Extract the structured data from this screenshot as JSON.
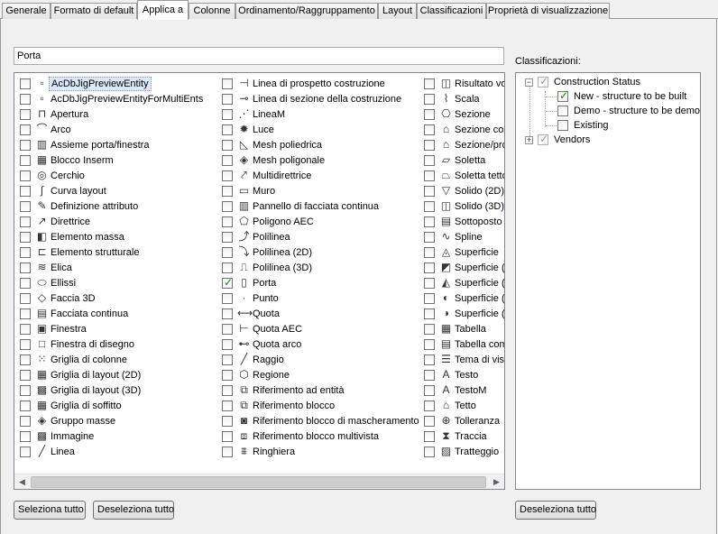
{
  "tabs": [
    {
      "label": "Generale"
    },
    {
      "label": "Formato di default"
    },
    {
      "label": "Applica a"
    },
    {
      "label": "Colonne"
    },
    {
      "label": "Ordinamento/Raggruppamento"
    },
    {
      "label": "Layout"
    },
    {
      "label": "Classificazioni"
    },
    {
      "label": "Proprietà di visualizzazione"
    }
  ],
  "active_tab": "Applica a",
  "filter": {
    "value": "Porta"
  },
  "objects": {
    "col1": [
      {
        "label": "AcDbJigPreviewEntity",
        "checked": false,
        "icon": "jig-preview-icon"
      },
      {
        "label": "AcDbJigPreviewEntityForMultiEnts",
        "checked": false,
        "icon": "jig-preview-icon"
      },
      {
        "label": "Apertura",
        "checked": false,
        "icon": "opening-icon"
      },
      {
        "label": "Arco",
        "checked": false,
        "icon": "arc-icon"
      },
      {
        "label": "Assieme porta/finestra",
        "checked": false,
        "icon": "door-window-assembly-icon"
      },
      {
        "label": "Blocco Inserm",
        "checked": false,
        "icon": "block-icon"
      },
      {
        "label": "Cerchio",
        "checked": false,
        "icon": "circle-icon"
      },
      {
        "label": "Curva layout",
        "checked": false,
        "icon": "layout-curve-icon"
      },
      {
        "label": "Definizione attributo",
        "checked": false,
        "icon": "attribute-definition-icon"
      },
      {
        "label": "Direttrice",
        "checked": false,
        "icon": "leader-icon"
      },
      {
        "label": "Elemento massa",
        "checked": false,
        "icon": "mass-element-icon"
      },
      {
        "label": "Elemento strutturale",
        "checked": false,
        "icon": "structural-member-icon"
      },
      {
        "label": "Elica",
        "checked": false,
        "icon": "helix-icon"
      },
      {
        "label": "Ellissi",
        "checked": false,
        "icon": "ellipse-icon"
      },
      {
        "label": "Faccia 3D",
        "checked": false,
        "icon": "face3d-icon"
      },
      {
        "label": "Facciata continua",
        "checked": false,
        "icon": "curtain-wall-icon"
      },
      {
        "label": "Finestra",
        "checked": false,
        "icon": "window-icon"
      },
      {
        "label": "Finestra di disegno",
        "checked": false,
        "icon": "viewport-icon"
      },
      {
        "label": "Griglia di colonne",
        "checked": false,
        "icon": "column-grid-icon"
      },
      {
        "label": "Griglia di layout (2D)",
        "checked": false,
        "icon": "layout-grid-2d-icon"
      },
      {
        "label": "Griglia di layout (3D)",
        "checked": false,
        "icon": "layout-grid-3d-icon"
      },
      {
        "label": "Griglia di soffitto",
        "checked": false,
        "icon": "ceiling-grid-icon"
      },
      {
        "label": "Gruppo masse",
        "checked": false,
        "icon": "mass-group-icon"
      },
      {
        "label": "Immagine",
        "checked": false,
        "icon": "image-icon"
      },
      {
        "label": "Linea",
        "checked": false,
        "icon": "line-icon"
      }
    ],
    "col2": [
      {
        "label": "Linea di prospetto costruzione",
        "checked": false,
        "icon": "elevation-line-icon"
      },
      {
        "label": "Linea di sezione della costruzione",
        "checked": false,
        "icon": "section-line-icon"
      },
      {
        "label": "LineaM",
        "checked": false,
        "icon": "mline-icon"
      },
      {
        "label": "Luce",
        "checked": false,
        "icon": "light-icon"
      },
      {
        "label": "Mesh poliedrica",
        "checked": false,
        "icon": "polyface-mesh-icon"
      },
      {
        "label": "Mesh poligonale",
        "checked": false,
        "icon": "polygon-mesh-icon"
      },
      {
        "label": "Multidirettrice",
        "checked": false,
        "icon": "multileader-icon"
      },
      {
        "label": "Muro",
        "checked": false,
        "icon": "wall-icon"
      },
      {
        "label": "Pannello di facciata continua",
        "checked": false,
        "icon": "curtain-panel-icon"
      },
      {
        "label": "Poligono AEC",
        "checked": false,
        "icon": "aec-polygon-icon"
      },
      {
        "label": "Polilinea",
        "checked": false,
        "icon": "polyline-icon"
      },
      {
        "label": "Polilinea (2D)",
        "checked": false,
        "icon": "polyline-2d-icon"
      },
      {
        "label": "Polilinea (3D)",
        "checked": false,
        "icon": "polyline-3d-icon"
      },
      {
        "label": "Porta",
        "checked": true,
        "icon": "door-icon"
      },
      {
        "label": "Punto",
        "checked": false,
        "icon": "point-icon"
      },
      {
        "label": "Quota",
        "checked": false,
        "icon": "dimension-icon"
      },
      {
        "label": "Quota AEC",
        "checked": false,
        "icon": "aec-dimension-icon"
      },
      {
        "label": "Quota arco",
        "checked": false,
        "icon": "arc-dimension-icon"
      },
      {
        "label": "Raggio",
        "checked": false,
        "icon": "ray-icon"
      },
      {
        "label": "Regione",
        "checked": false,
        "icon": "region-icon"
      },
      {
        "label": "Riferimento ad entità",
        "checked": false,
        "icon": "entity-reference-icon"
      },
      {
        "label": "Riferimento blocco",
        "checked": false,
        "icon": "block-reference-icon"
      },
      {
        "label": "Riferimento blocco di mascheramento",
        "checked": false,
        "icon": "masking-block-icon"
      },
      {
        "label": "Riferimento blocco multivista",
        "checked": false,
        "icon": "multiview-block-icon"
      },
      {
        "label": "Ringhiera",
        "checked": false,
        "icon": "railing-icon"
      }
    ],
    "col3": [
      {
        "label": "Risultato vo",
        "checked": false,
        "icon": "volume-result-icon"
      },
      {
        "label": "Scala",
        "checked": false,
        "icon": "stair-icon"
      },
      {
        "label": "Sezione",
        "checked": false,
        "icon": "section-icon"
      },
      {
        "label": "Sezione cos",
        "checked": false,
        "icon": "building-section-icon"
      },
      {
        "label": "Sezione/pro",
        "checked": false,
        "icon": "section-profile-icon"
      },
      {
        "label": "Soletta",
        "checked": false,
        "icon": "slab-icon"
      },
      {
        "label": "Soletta tetto",
        "checked": false,
        "icon": "roof-slab-icon"
      },
      {
        "label": "Solido (2D)",
        "checked": false,
        "icon": "solid-2d-icon"
      },
      {
        "label": "Solido (3D)",
        "checked": false,
        "icon": "solid-3d-icon"
      },
      {
        "label": "Sottoposto I",
        "checked": false,
        "icon": "pdf-underlay-icon"
      },
      {
        "label": "Spline",
        "checked": false,
        "icon": "spline-icon"
      },
      {
        "label": "Superficie",
        "checked": false,
        "icon": "surface-icon"
      },
      {
        "label": "Superficie (e",
        "checked": false,
        "icon": "surface-extruded-icon"
      },
      {
        "label": "Superficie (p",
        "checked": false,
        "icon": "surface-planar-icon"
      },
      {
        "label": "Superficie (r",
        "checked": false,
        "icon": "surface-revolved-icon"
      },
      {
        "label": "Superficie (s",
        "checked": false,
        "icon": "surface-swept-icon"
      },
      {
        "label": "Tabella",
        "checked": false,
        "icon": "table-icon"
      },
      {
        "label": "Tabella com",
        "checked": false,
        "icon": "table-combined-icon"
      },
      {
        "label": "Tema di visu",
        "checked": false,
        "icon": "display-theme-icon"
      },
      {
        "label": "Testo",
        "checked": false,
        "icon": "text-icon"
      },
      {
        "label": "TestoM",
        "checked": false,
        "icon": "mtext-icon"
      },
      {
        "label": "Tetto",
        "checked": false,
        "icon": "roof-icon"
      },
      {
        "label": "Tolleranza",
        "checked": false,
        "icon": "tolerance-icon"
      },
      {
        "label": "Traccia",
        "checked": false,
        "icon": "trace-icon"
      },
      {
        "label": "Tratteggio",
        "checked": false,
        "icon": "hatch-icon"
      }
    ]
  },
  "classifications": {
    "label": "Classificazioni:",
    "tree": {
      "construction_status": {
        "label": "Construction Status",
        "checked": true,
        "grayed": true
      },
      "new": {
        "label": "New - structure to be built",
        "checked": true
      },
      "demo": {
        "label": "Demo - structure to be demolis",
        "checked": false
      },
      "existing": {
        "label": "Existing",
        "checked": false
      },
      "vendors": {
        "label": "Vendors",
        "checked": true,
        "grayed": true
      }
    }
  },
  "buttons": {
    "select_all": "Seleziona tutto",
    "deselect_all_left": "Deseleziona tutto",
    "deselect_all_right": "Deseleziona tutto"
  }
}
